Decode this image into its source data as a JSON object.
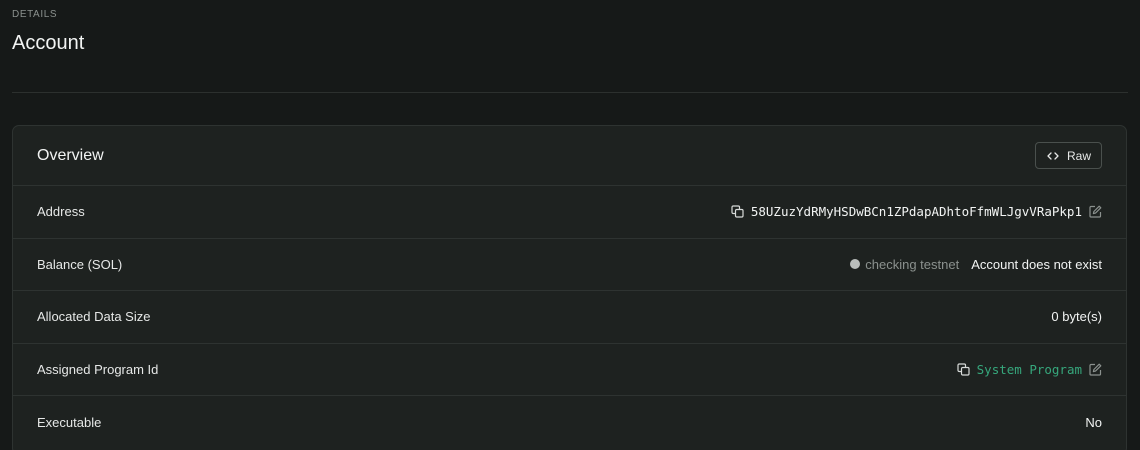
{
  "header": {
    "eyebrow": "DETAILS",
    "title": "Account"
  },
  "card": {
    "title": "Overview",
    "raw_button_label": "Raw",
    "rows": [
      {
        "label": "Address",
        "value": "58UZuzYdRMyHSDwBCn1ZPdapADhtoFfmWLJgvVRaPkp1"
      },
      {
        "label": "Balance (SOL)",
        "status": "checking testnet",
        "value": "Account does not exist"
      },
      {
        "label": "Allocated Data Size",
        "value": "0 byte(s)"
      },
      {
        "label": "Assigned Program Id",
        "value": "System Program"
      },
      {
        "label": "Executable",
        "value": "No"
      }
    ]
  },
  "icons": {
    "copy": "copy-icon",
    "edit": "edit-icon",
    "code": "code-icon",
    "status_dot": "status-dot-icon"
  },
  "colors": {
    "background": "#161918",
    "card": "#1e2220",
    "border": "#2e3331",
    "link": "#36a77c",
    "muted": "#8b918e"
  }
}
